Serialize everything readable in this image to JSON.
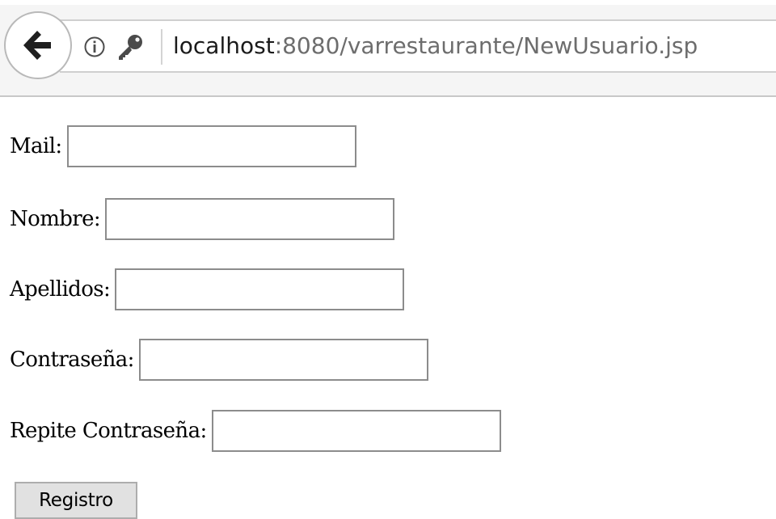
{
  "browser": {
    "back_icon": "arrow-left-icon",
    "info_icon": "info-icon",
    "key_icon": "key-icon",
    "url_host": "localhost",
    "url_rest": ":8080/varrestaurante/NewUsuario.jsp"
  },
  "form": {
    "mail": {
      "label": "Mail:",
      "value": ""
    },
    "nombre": {
      "label": "Nombre:",
      "value": ""
    },
    "apellidos": {
      "label": "Apellidos:",
      "value": ""
    },
    "contrasena": {
      "label": "Contraseña:",
      "value": ""
    },
    "repite": {
      "label": "Repite Contraseña:",
      "value": ""
    },
    "submit_label": "Registro"
  },
  "colors": {
    "toolbar_bg": "#f5f5f5",
    "url_host": "#1a1a1a",
    "url_path": "#6d6d6d",
    "button_bg": "#e1e1e1"
  }
}
